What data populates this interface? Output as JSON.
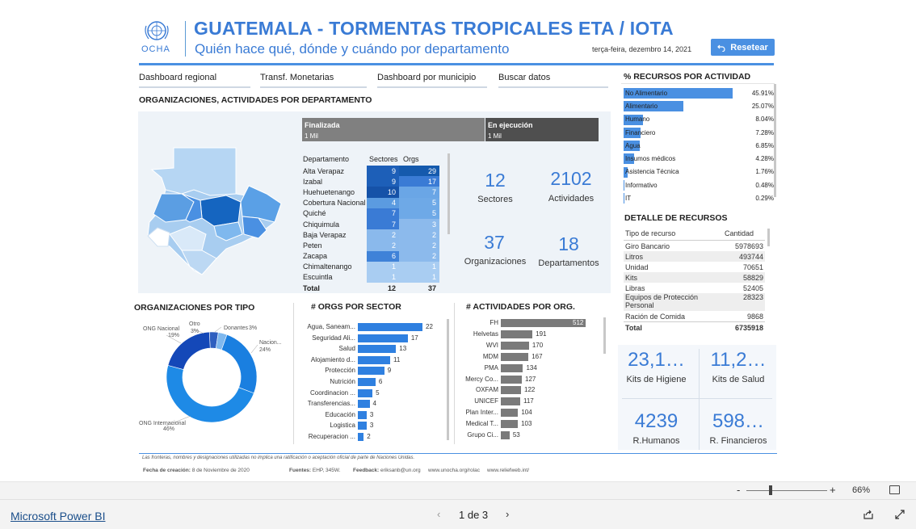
{
  "header": {
    "logo_text": "OCHA",
    "title": "GUATEMALA - TORMENTAS TROPICALES ETA / IOTA",
    "subtitle": "Quién hace qué, dónde y cuándo por departamento",
    "date": "terça-feira, dezembro 14, 2021",
    "reset_label": "Resetear"
  },
  "nav": [
    "Dashboard regional",
    "Transf. Monetarias",
    "Dashboard por municipio",
    "Buscar datos"
  ],
  "orgs_section": {
    "title": "ORGANIZACIONES, ACTIVIDADES POR DEPARTAMENTO",
    "status": [
      {
        "label": "Finalizada",
        "value": "1 Mil"
      },
      {
        "label": "En ejecución",
        "value": "1 Mil"
      }
    ],
    "table": {
      "headers": [
        "Departamento",
        "Sectores",
        "Orgs"
      ],
      "rows": [
        {
          "dept": "Alta Verapaz",
          "sectores": "9",
          "orgs": "29"
        },
        {
          "dept": "Izabal",
          "sectores": "9",
          "orgs": "17"
        },
        {
          "dept": "Huehuetenango",
          "sectores": "10",
          "orgs": "7"
        },
        {
          "dept": "Cobertura Nacional",
          "sectores": "4",
          "orgs": "5"
        },
        {
          "dept": "Quiché",
          "sectores": "7",
          "orgs": "5"
        },
        {
          "dept": "Chiquimula",
          "sectores": "7",
          "orgs": "3"
        },
        {
          "dept": "Baja Verapaz",
          "sectores": "2",
          "orgs": "2"
        },
        {
          "dept": "Peten",
          "sectores": "2",
          "orgs": "2"
        },
        {
          "dept": "Zacapa",
          "sectores": "6",
          "orgs": "2"
        },
        {
          "dept": "Chimaltenango",
          "sectores": "1",
          "orgs": "1"
        },
        {
          "dept": "Escuintla",
          "sectores": "1",
          "orgs": "1"
        }
      ],
      "total": {
        "label": "Total",
        "sectores": "12",
        "orgs": "37"
      }
    },
    "stats": [
      {
        "num": "12",
        "label": "Sectores"
      },
      {
        "num": "2102",
        "label": "Actividades"
      },
      {
        "num": "37",
        "label": "Organizaciones"
      },
      {
        "num": "18",
        "label": "Departamentos"
      }
    ]
  },
  "recursos": {
    "title": "% RECURSOS POR ACTIVIDAD",
    "items": [
      {
        "name": "No Alimentario",
        "pct": 45.91,
        "label": "45.91%"
      },
      {
        "name": "Alimentario",
        "pct": 25.07,
        "label": "25.07%"
      },
      {
        "name": "Humano",
        "pct": 8.04,
        "label": "8.04%"
      },
      {
        "name": "Financiero",
        "pct": 7.28,
        "label": "7.28%"
      },
      {
        "name": "Agua",
        "pct": 6.85,
        "label": "6.85%"
      },
      {
        "name": "Insumos médicos",
        "pct": 4.28,
        "label": "4.28%"
      },
      {
        "name": "Asistencia Técnica",
        "pct": 1.76,
        "label": "1.76%"
      },
      {
        "name": "Informativo",
        "pct": 0.48,
        "label": "0.48%"
      },
      {
        "name": "IT",
        "pct": 0.29,
        "label": "0.29%"
      }
    ]
  },
  "detalle": {
    "title": "DETALLE DE RECURSOS",
    "headers": [
      "Tipo de recurso",
      "Cantidad"
    ],
    "rows": [
      {
        "tipo": "Giro Bancario",
        "cant": "5978693"
      },
      {
        "tipo": "Litros",
        "cant": "493744"
      },
      {
        "tipo": "Unidad",
        "cant": "70651"
      },
      {
        "tipo": "Kits",
        "cant": "58829"
      },
      {
        "tipo": "Libras",
        "cant": "52405"
      },
      {
        "tipo": "Equipos de Protección Personal",
        "cant": "28323"
      },
      {
        "tipo": "Ración de Comida",
        "cant": "9868"
      }
    ],
    "total": {
      "label": "Total",
      "cant": "6735918"
    }
  },
  "cards": [
    {
      "num": "23,1…",
      "label": "Kits de Higiene"
    },
    {
      "num": "11,2…",
      "label": "Kits de Salud"
    },
    {
      "num": "4239",
      "label": "R.Humanos"
    },
    {
      "num": "598…",
      "label": "R. Financieros"
    }
  ],
  "tipo": {
    "title": "ORGANIZACIONES POR TIPO",
    "chart_data": {
      "type": "pie",
      "slices": [
        {
          "name": "ONG Internacional",
          "value": 46,
          "label": "46%",
          "color": "#1e8ae6"
        },
        {
          "name": "Naciones Unidas",
          "value": 24,
          "label": "24%",
          "color": "#1a7fe0"
        },
        {
          "name": "Donantes",
          "value": 3,
          "label": "3%",
          "color": "#7fb8ee"
        },
        {
          "name": "Otro",
          "value": 3,
          "label": "3%",
          "color": "#2f5fbf"
        },
        {
          "name": "ONG Nacional",
          "value": 19,
          "label": "19%",
          "color": "#1448b8"
        }
      ],
      "legend": [
        {
          "name": "ONG Nacional",
          "label": "19%"
        },
        {
          "name": "Otro",
          "label": "3%"
        },
        {
          "name": "Donantes",
          "label": "3%"
        },
        {
          "name": "Nacion...",
          "label": "24%"
        },
        {
          "name": "ONG Internacional",
          "label": "46%"
        }
      ]
    }
  },
  "sector": {
    "title": "# ORGS POR SECTOR",
    "chart_data": {
      "type": "bar",
      "categories": [
        "Agua, Saneam...",
        "Seguridad Ali...",
        "Salud",
        "Alojamiento d...",
        "Protección",
        "Nutrición",
        "Coordinacion ...",
        "Transferencias...",
        "Educación",
        "Logistica",
        "Recuperacion ..."
      ],
      "values": [
        22,
        17,
        13,
        11,
        9,
        6,
        5,
        4,
        3,
        3,
        2
      ],
      "color": "#2f80e0"
    }
  },
  "actividades": {
    "title": "# ACTIVIDADES POR ORG.",
    "chart_data": {
      "type": "bar",
      "categories": [
        "FH",
        "Helvetas",
        "WVI",
        "MDM",
        "PMA",
        "Mercy Co...",
        "OXFAM",
        "UNICEF",
        "Plan Inter...",
        "Medical T...",
        "Grupo Ci..."
      ],
      "values": [
        512,
        191,
        170,
        167,
        134,
        127,
        122,
        117,
        104,
        103,
        53
      ],
      "color": "#7a7a7a"
    }
  },
  "footer": {
    "disclaimer": "Las fronteras, nombres y designaciones utilizadas no implica una ratificación o aceptación oficial de parte de Naciones Unidas.",
    "fecha_label": "Fecha de creación:",
    "fecha_value": "8 de Noviembre de 2020",
    "fuentes_label": "Fuentes:",
    "fuentes_value": "EHP, 345W.",
    "feedback_label": "Feedback:",
    "feedback_value": "eriksanb@un.org",
    "link1": "www.unocha.org/rolac",
    "link2": "www.reliefweb.int/"
  },
  "zoom": {
    "minus": "-",
    "plus": "+",
    "value": "66%"
  },
  "powerbi": {
    "brand": "Microsoft Power BI",
    "page": "1 de 3"
  }
}
